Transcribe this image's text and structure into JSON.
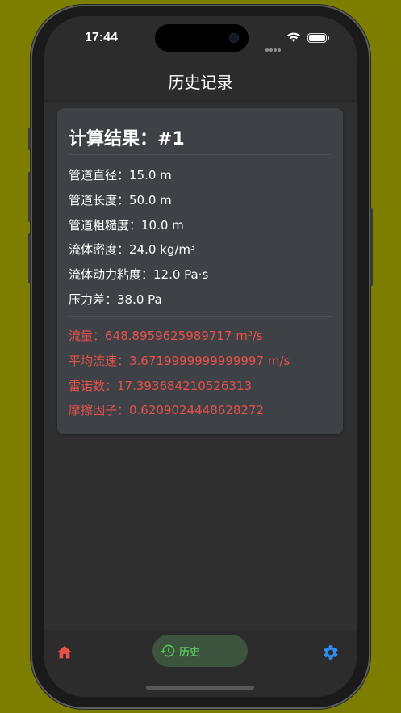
{
  "status_bar": {
    "time": "17:44"
  },
  "app_bar": {
    "title": "历史记录"
  },
  "card": {
    "title": "计算结果：#1",
    "inputs": [
      "管道直径：15.0 m",
      "管道长度：50.0 m",
      "管道粗糙度：10.0 m",
      "流体密度：24.0 kg/m³",
      "流体动力粘度：12.0 Pa·s",
      "压力差：38.0 Pa"
    ],
    "results": [
      "流量：648.8959625989717 m³/s",
      "平均流速：3.6719999999999997 m/s",
      "雷诺数：17.393684210526313",
      "摩擦因子：0.6209024448628272"
    ]
  },
  "bottom_nav": {
    "items": [
      {
        "icon": "home-icon",
        "label": "",
        "color": "#e8504a"
      },
      {
        "icon": "history-icon",
        "label": "历史",
        "color": "#55c05a",
        "selected": true
      },
      {
        "icon": "gear-icon",
        "label": "",
        "color": "#2f8cf0"
      }
    ]
  },
  "colors": {
    "background": "#7d7d00",
    "screen": "#303030",
    "card": "#3e4246",
    "result_text": "#e8504a"
  }
}
